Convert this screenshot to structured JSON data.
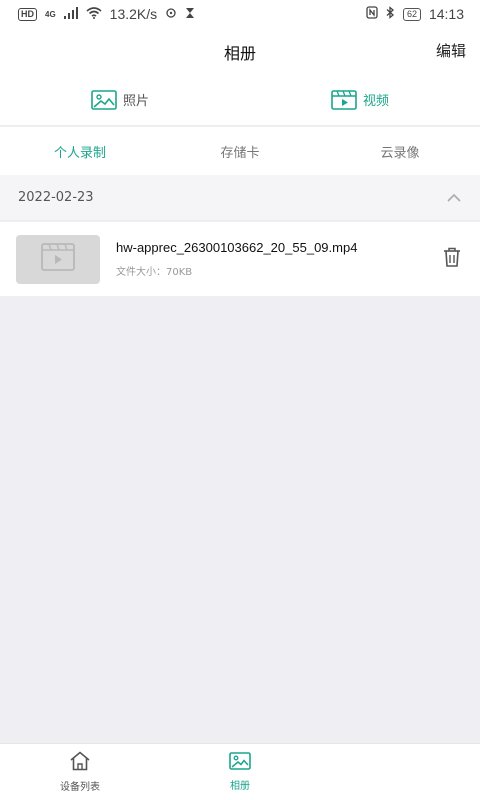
{
  "status_bar": {
    "hd": "HD",
    "network": "4G",
    "speed": "13.2K/s",
    "battery": "62",
    "time": "14:13"
  },
  "header": {
    "title": "相册",
    "edit_label": "编辑"
  },
  "type_tabs": [
    {
      "label": "照片",
      "icon": "image-icon",
      "active": false
    },
    {
      "label": "视频",
      "icon": "video-icon",
      "active": true
    }
  ],
  "sub_tabs": [
    {
      "label": "个人录制",
      "active": true
    },
    {
      "label": "存储卡",
      "active": false
    },
    {
      "label": "云录像",
      "active": false
    }
  ],
  "groups": [
    {
      "date": "2022-02-23",
      "expanded": true,
      "files": [
        {
          "name": "hw-apprec_26300103662_20_55_09.mp4",
          "size_label": "文件大小：70KB"
        }
      ]
    }
  ],
  "bottom_nav": [
    {
      "label": "设备列表",
      "icon": "home-icon",
      "active": false
    },
    {
      "label": "相册",
      "icon": "image-icon",
      "active": true
    }
  ],
  "colors": {
    "accent": "#1aa58c",
    "background": "#efeff3"
  }
}
